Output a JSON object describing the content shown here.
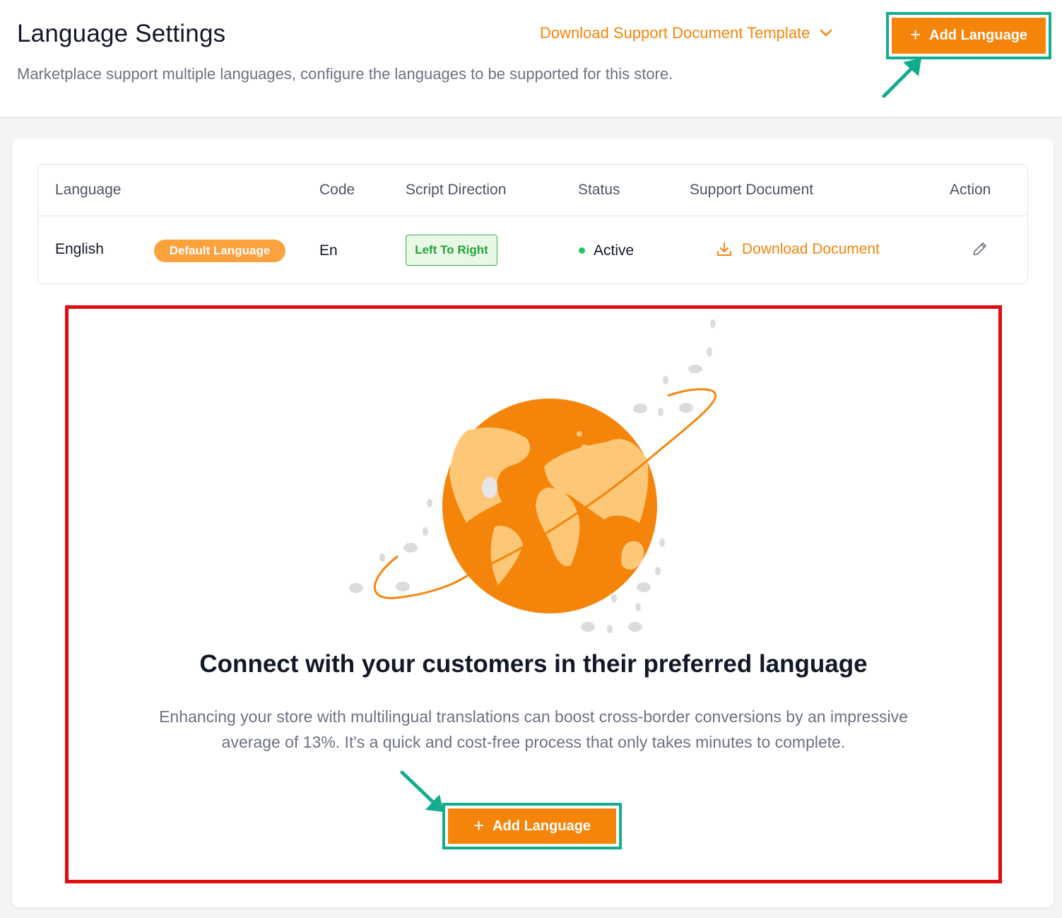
{
  "header": {
    "title": "Language Settings",
    "subtitle": "Marketplace support multiple languages, configure the languages to be supported for this store.",
    "download_template_label": "Download Support Document Template",
    "add_language_label": "Add Language"
  },
  "table": {
    "columns": [
      "Language",
      "Code",
      "Script Direction",
      "Status",
      "Support Document",
      "Action"
    ],
    "rows": [
      {
        "language": "English",
        "default_badge": "Default Language",
        "code": "En",
        "script_direction": "Left To Right",
        "status": "Active",
        "support_document": "Download Document"
      }
    ]
  },
  "empty_state": {
    "title": "Connect with your customers in their preferred language",
    "description": "Enhancing your store with multilingual translations can boost cross-border conversions by an impressive average of 13%. It's a quick and cost-free process that only takes minutes to complete.",
    "add_language_label": "Add Language"
  },
  "icons": {
    "header_dropdown": "chevron-down-icon",
    "add": "plus-icon",
    "download": "download-icon",
    "edit": "pencil-icon",
    "illustration": "globe-illustration"
  },
  "colors": {
    "accent": "#f5850a",
    "highlight": "#12ad8e",
    "annotation_box": "#e10d0d",
    "status_active": "#22c55e"
  }
}
